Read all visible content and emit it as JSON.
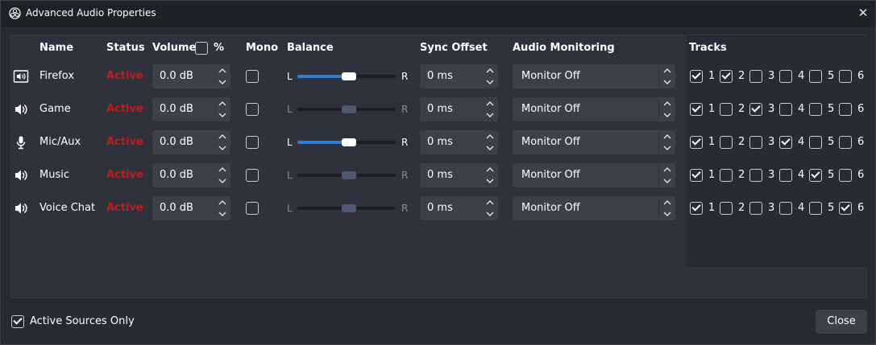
{
  "window": {
    "title": "Advanced Audio Properties",
    "close_glyph": "✕"
  },
  "headers": {
    "name": "Name",
    "status": "Status",
    "volume": "Volume",
    "volume_unit": "%",
    "mono": "Mono",
    "balance": "Balance",
    "sync_offset": "Sync Offset",
    "audio_monitoring": "Audio Monitoring",
    "tracks": "Tracks"
  },
  "balance_labels": {
    "left": "L",
    "right": "R"
  },
  "track_numbers": [
    "1",
    "2",
    "3",
    "4",
    "5",
    "6"
  ],
  "sources": [
    {
      "icon": "browser-source-icon",
      "name": "Firefox",
      "status": "Active",
      "volume": "0.0 dB",
      "mono": false,
      "balance_active": true,
      "sync": "0 ms",
      "monitoring": "Monitor Off",
      "tracks": [
        true,
        true,
        false,
        false,
        false,
        false
      ]
    },
    {
      "icon": "speaker-icon",
      "name": "Game",
      "status": "Active",
      "volume": "0.0 dB",
      "mono": false,
      "balance_active": false,
      "sync": "0 ms",
      "monitoring": "Monitor Off",
      "tracks": [
        true,
        false,
        true,
        false,
        false,
        false
      ]
    },
    {
      "icon": "microphone-icon",
      "name": "Mic/Aux",
      "status": "Active",
      "volume": "0.0 dB",
      "mono": false,
      "balance_active": true,
      "sync": "0 ms",
      "monitoring": "Monitor Off",
      "tracks": [
        true,
        false,
        false,
        true,
        false,
        false
      ]
    },
    {
      "icon": "speaker-icon",
      "name": "Music",
      "status": "Active",
      "volume": "0.0 dB",
      "mono": false,
      "balance_active": false,
      "sync": "0 ms",
      "monitoring": "Monitor Off",
      "tracks": [
        true,
        false,
        false,
        false,
        true,
        false
      ]
    },
    {
      "icon": "speaker-icon",
      "name": "Voice Chat",
      "status": "Active",
      "volume": "0.0 dB",
      "mono": false,
      "balance_active": false,
      "sync": "0 ms",
      "monitoring": "Monitor Off",
      "tracks": [
        true,
        false,
        false,
        false,
        false,
        true
      ]
    }
  ],
  "balance_value": 0.5,
  "footer": {
    "active_sources_only": "Active Sources Only",
    "active_sources_checked": true,
    "close_label": "Close"
  },
  "colors": {
    "status_active": "#c01c1c",
    "slider_fill": "#2f7fd6"
  }
}
